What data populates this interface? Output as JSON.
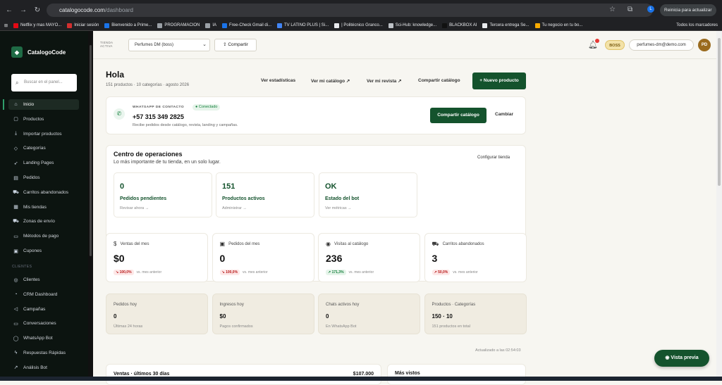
{
  "browser": {
    "url_host": "catalogocode.com",
    "url_path": "/dashboard",
    "update_label": "Reinicia para actualizar",
    "profile_initial": "L",
    "bookmarks": [
      {
        "label": "Netflix y mas MAYO...",
        "color": "#e50914"
      },
      {
        "label": "Iniciar sesión",
        "color": "#d32f2f"
      },
      {
        "label": "Bienvenido a Prime...",
        "color": "#1a73e8"
      },
      {
        "label": "PROGRAMACION",
        "color": "#9aa0a6"
      },
      {
        "label": "IA",
        "color": "#9aa0a6"
      },
      {
        "label": "Free-Check Gmail di...",
        "color": "#1a73e8"
      },
      {
        "label": "TV LATINO PLUS | Si...",
        "color": "#4285f4"
      },
      {
        "label": "| Politécnico Granco...",
        "color": "#e8eaed"
      },
      {
        "label": "Sci-Hub: knowledge...",
        "color": "#bdc1c6"
      },
      {
        "label": "BLACKBOX AI",
        "color": "#111111"
      },
      {
        "label": "Tercera entrega Se...",
        "color": "#e8eaed"
      },
      {
        "label": "Tu negocio en tu bo...",
        "color": "#f9ab00"
      }
    ],
    "all_bookmarks": "Todos los marcadores"
  },
  "sidebar": {
    "brand": "CatalogoCode",
    "search_placeholder": "Buscar en el panel...",
    "items": [
      {
        "label": "Inicio",
        "icon": "home-icon",
        "glyph": "⌂"
      },
      {
        "label": "Productos",
        "icon": "box-icon",
        "glyph": "▢"
      },
      {
        "label": "Importar productos",
        "icon": "download-icon",
        "glyph": "⤓"
      },
      {
        "label": "Categorías",
        "icon": "tag-icon",
        "glyph": "◇"
      },
      {
        "label": "Landing Pages",
        "icon": "rocket-icon",
        "glyph": "➶"
      },
      {
        "label": "Pedidos",
        "icon": "clipboard-icon",
        "glyph": "▤"
      },
      {
        "label": "Carritos abandonados",
        "icon": "cart-icon",
        "glyph": "⛟"
      },
      {
        "label": "Mis tiendas",
        "icon": "store-icon",
        "glyph": "▦"
      },
      {
        "label": "Zonas de envío",
        "icon": "truck-icon",
        "glyph": "⛟"
      },
      {
        "label": "Métodos de pago",
        "icon": "card-icon",
        "glyph": "▭"
      },
      {
        "label": "Cupones",
        "icon": "ticket-icon",
        "glyph": "▣"
      }
    ],
    "section_clientes": "CLIENTES",
    "items2": [
      {
        "label": "Clientes",
        "icon": "users-icon",
        "glyph": "◎"
      },
      {
        "label": "CRM Dashboard",
        "icon": "gauge-icon",
        "glyph": "◔"
      },
      {
        "label": "Campañas",
        "icon": "megaphone-icon",
        "glyph": "◁"
      },
      {
        "label": "Conversaciones",
        "icon": "chat-icon",
        "glyph": "▭"
      },
      {
        "label": "WhatsApp Bot",
        "icon": "whatsapp-icon",
        "glyph": "◯"
      },
      {
        "label": "Respuestas Rápidas",
        "icon": "bolt-icon",
        "glyph": "ϟ"
      },
      {
        "label": "Análisis Bot",
        "icon": "trend-icon",
        "glyph": "↗"
      }
    ]
  },
  "topbar": {
    "store_label": "TIENDA ACTIVA",
    "store_selected": "Perfumes DM (boss)",
    "share_label": "Compartir",
    "role_badge": "BOSS",
    "email": "perfumes-dm@demo.com",
    "avatar_initials": "PD"
  },
  "header": {
    "greeting": "Hola",
    "summary": "151 productos · 10 categorías · agosto 2026",
    "links": [
      {
        "label": "Ver estadísticas"
      },
      {
        "label": "Ver mi catálogo ↗"
      },
      {
        "label": "Ver mi revista ↗"
      },
      {
        "label": "Compartir catálogo"
      }
    ],
    "new_product": "+ Nuevo producto"
  },
  "whatsapp": {
    "label": "WHATSAPP DE CONTACTO",
    "status": "● Conectado",
    "number": "+57 315 349 2825",
    "desc": "Recibe pedidos desde catálogo, revista, landing y campañas.",
    "share_btn": "Compartir catálogo",
    "change_btn": "Cambiar"
  },
  "ops": {
    "title": "Centro de operaciones",
    "subtitle": "Lo más importante de tu tienda, en un solo lugar.",
    "config": "Configurar tienda",
    "cards": [
      {
        "value": "0",
        "label": "Pedidos pendientes",
        "action": "Revisar ahora →"
      },
      {
        "value": "151",
        "label": "Productos activos",
        "action": "Administrar →"
      },
      {
        "value": "OK",
        "label": "Estado del bot",
        "action": "Ver métricas →"
      }
    ]
  },
  "stats": [
    {
      "title": "Ventas del mes",
      "icon": "dollar-icon",
      "glyph": "$",
      "value": "$0",
      "delta": "↘ 100,0%",
      "tone": "red",
      "note": "vs. mes anterior"
    },
    {
      "title": "Pedidos del mes",
      "icon": "bag-icon",
      "glyph": "▣",
      "value": "0",
      "delta": "↘ 100,0%",
      "tone": "red",
      "note": "vs. mes anterior"
    },
    {
      "title": "Visitas al catálogo",
      "icon": "eye-icon",
      "glyph": "◉",
      "value": "236",
      "delta": "↗ 171,3%",
      "tone": "grn",
      "note": "vs. mes anterior"
    },
    {
      "title": "Carritos abandonados",
      "icon": "cart-icon",
      "glyph": "⛟",
      "value": "3",
      "delta": "↗ 50,0%",
      "tone": "red",
      "note": "vs. mes anterior"
    }
  ],
  "today": [
    {
      "title": "Pedidos hoy",
      "value": "0",
      "note": "Últimas 24 horas"
    },
    {
      "title": "Ingresos hoy",
      "value": "$0",
      "note": "Pagos confirmados"
    },
    {
      "title": "Chats activos hoy",
      "value": "0",
      "note": "En WhatsApp Bot"
    },
    {
      "title": "Productos · Categorías",
      "value": "150 · 10",
      "note": "151 productos en total"
    }
  ],
  "updated": "Actualizado a las 02:54:03",
  "bottom": {
    "sales_title": "Ventas · últimos 30 días",
    "sales_value": "$107.000",
    "top_title": "Más vistos"
  },
  "preview_btn": "◉  Vista previa"
}
